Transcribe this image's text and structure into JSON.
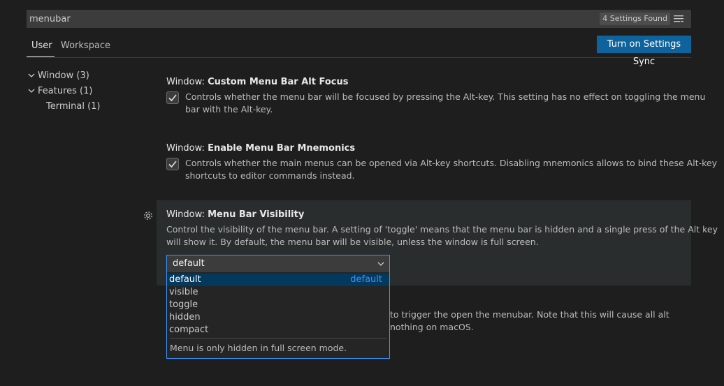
{
  "search": {
    "value": "menubar",
    "count_label": "4 Settings Found"
  },
  "tabs": [
    {
      "label": "User"
    },
    {
      "label": "Workspace"
    }
  ],
  "sync_button": {
    "label": "Turn on Settings Sync"
  },
  "toc": [
    {
      "label": "Window (3)"
    },
    {
      "label": "Features (1)"
    },
    {
      "label": "Terminal (1)"
    }
  ],
  "settings": [
    {
      "category": "Window: ",
      "name": "Custom Menu Bar Alt Focus",
      "checked": true,
      "desc_lines": [
        "Controls whether the menu bar will be focused by pressing the Alt-key. This setting has no effect on toggling the menu",
        "bar with the Alt-key."
      ]
    },
    {
      "category": "Window: ",
      "name": "Enable Menu Bar Mnemonics",
      "checked": true,
      "desc_lines": [
        "Controls whether the main menus can be opened via Alt-key shortcuts. Disabling mnemonics allows to bind these Alt-key",
        "shortcuts to editor commands instead."
      ]
    },
    {
      "category": "Window: ",
      "name": "Menu Bar Visibility",
      "desc_lines": [
        "Control the visibility of the menu bar. A setting of 'toggle' means that the menu bar is hidden and a single press of the Alt key",
        "will show it. By default, the menu bar will be visible, unless the window is full screen."
      ],
      "select_value": "default",
      "options": [
        {
          "label": "default",
          "tag": "default"
        },
        {
          "label": "visible"
        },
        {
          "label": "toggle"
        },
        {
          "label": "hidden"
        },
        {
          "label": "compact"
        }
      ],
      "option_description": "Menu is only hidden in full screen mode."
    }
  ],
  "hidden_setting_fragment": {
    "line1": "to trigger the open the menubar. Note that this will cause all alt",
    "line2": "nothing on macOS."
  },
  "colors": {
    "accent": "#3794ff",
    "sync_button": "#0e639c",
    "background": "#1e1e1e"
  }
}
